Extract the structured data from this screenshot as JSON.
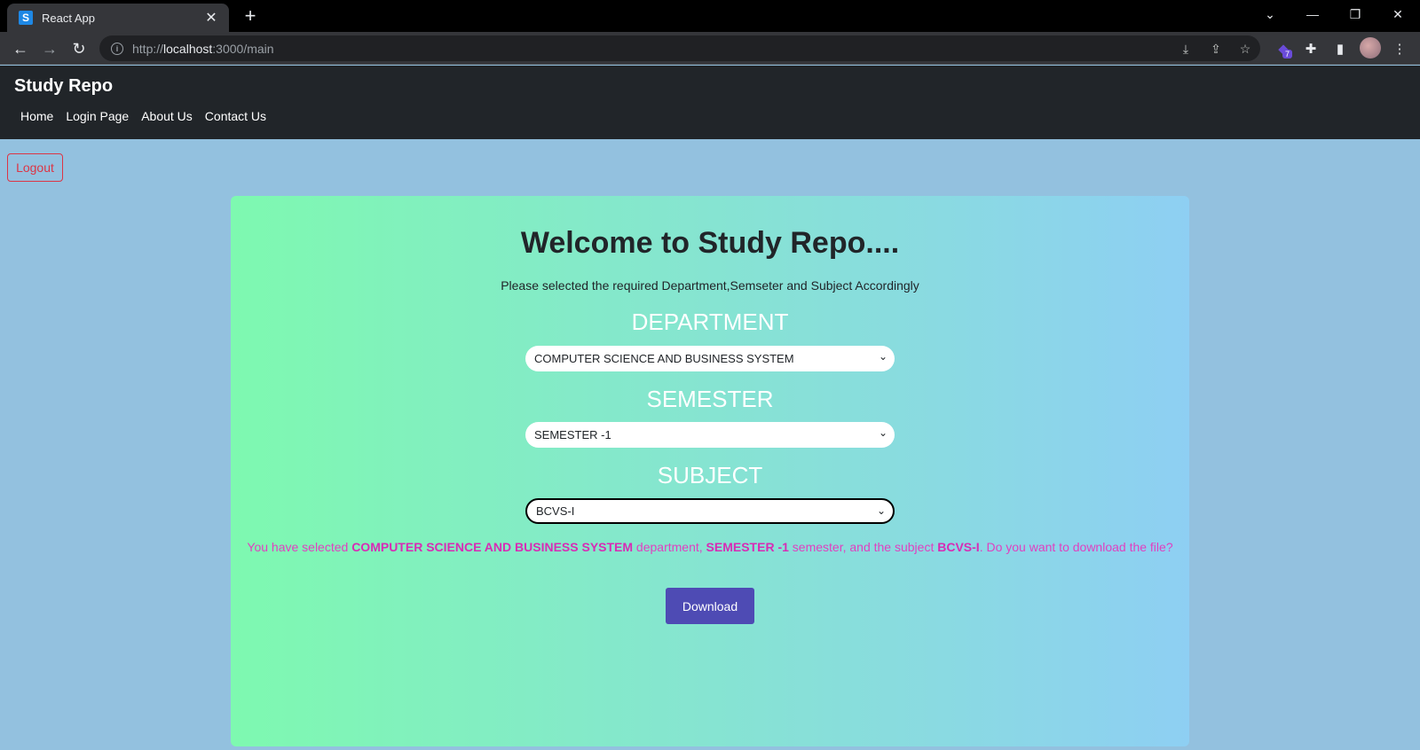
{
  "browser": {
    "tab_title": "React App",
    "favicon_letter": "S",
    "url_prefix": "http://",
    "url_host": "localhost",
    "url_rest": ":3000/main",
    "extension_badge": "7"
  },
  "navbar": {
    "brand": "Study Repo",
    "links": [
      "Home",
      "Login Page",
      "About Us",
      "Contact Us"
    ]
  },
  "logout_label": "Logout",
  "main": {
    "headline": "Welcome to Study Repo....",
    "subtitle": "Please selected the required Department,Semseter and Subject Accordingly",
    "department_label": "DEPARTMENT",
    "department_value": "COMPUTER SCIENCE AND BUSINESS SYSTEM",
    "semester_label": "SEMESTER",
    "semester_value": "SEMESTER -1",
    "subject_label": "SUBJECT",
    "subject_value": "BCVS-I",
    "summary": {
      "p1": "You have selected ",
      "dept": "COMPUTER SCIENCE AND BUSINESS SYSTEM",
      "p2": " department, ",
      "sem": "SEMESTER -1",
      "p3": " semester, and the subject ",
      "subj": "BCVS-I",
      "p4": ". Do you want to download the file?"
    },
    "download_label": "Download"
  },
  "colors": {
    "navbar_bg": "#212529",
    "page_bg": "#93c1df",
    "card_gradient_start": "#7ef9b0",
    "card_gradient_end": "#8ecff3",
    "summary_text": "#e040c0",
    "download_bg": "#4e4bb4",
    "logout": "#dc3545"
  }
}
